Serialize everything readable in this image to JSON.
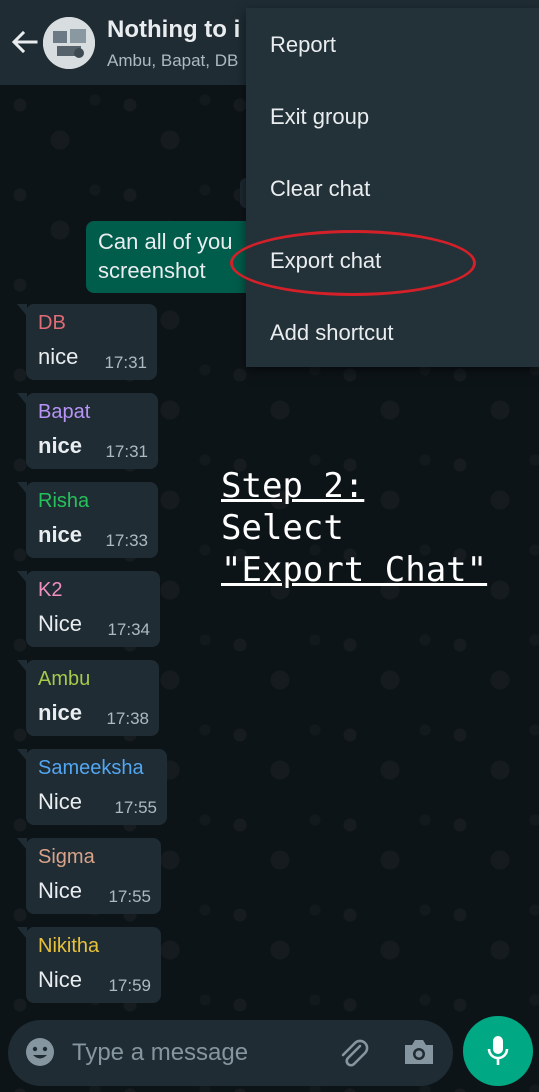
{
  "header": {
    "title": "Nothing to i",
    "subtitle": "Ambu, Bapat, DB"
  },
  "outgoing_message": {
    "line1": "Can all of you",
    "line2": "screenshot"
  },
  "messages": [
    {
      "sender": "DB",
      "sender_color": "#e06c75",
      "text": "nice",
      "time": "17:31",
      "bold": false
    },
    {
      "sender": "Bapat",
      "sender_color": "#b794f6",
      "text": "nice",
      "time": "17:31",
      "bold": true
    },
    {
      "sender": "Risha",
      "sender_color": "#25c15b",
      "text": "nice",
      "time": "17:33",
      "bold": true
    },
    {
      "sender": "K2",
      "sender_color": "#f08fc0",
      "text": "Nice",
      "time": "17:34",
      "bold": false
    },
    {
      "sender": "Ambu",
      "sender_color": "#a5c94a",
      "text": "nice",
      "time": "17:38",
      "bold": true
    },
    {
      "sender": "Sameeksha",
      "sender_color": "#53a6f0",
      "text": "Nice",
      "time": "17:55",
      "bold": false
    },
    {
      "sender": "Sigma",
      "sender_color": "#d9a38a",
      "text": "Nice",
      "time": "17:55",
      "bold": false
    },
    {
      "sender": "Nikitha",
      "sender_color": "#e8c13a",
      "text": "Nice",
      "time": "17:59",
      "bold": false
    }
  ],
  "menu": {
    "items": [
      "Report",
      "Exit group",
      "Clear chat",
      "Export chat",
      "Add shortcut"
    ]
  },
  "annotation": {
    "line1": "Step 2:",
    "line2": "Select",
    "line3": "\"Export Chat\""
  },
  "input": {
    "placeholder": "Type a message"
  },
  "colors": {
    "header_bg": "#1f2c34",
    "outgoing_bubble": "#005c4b",
    "incoming_bubble": "#1f2c34",
    "accent": "#00a884",
    "highlight_ring": "#d42028"
  },
  "icons": [
    "back-arrow-icon",
    "emoji-icon",
    "attach-icon",
    "camera-icon",
    "mic-icon"
  ]
}
